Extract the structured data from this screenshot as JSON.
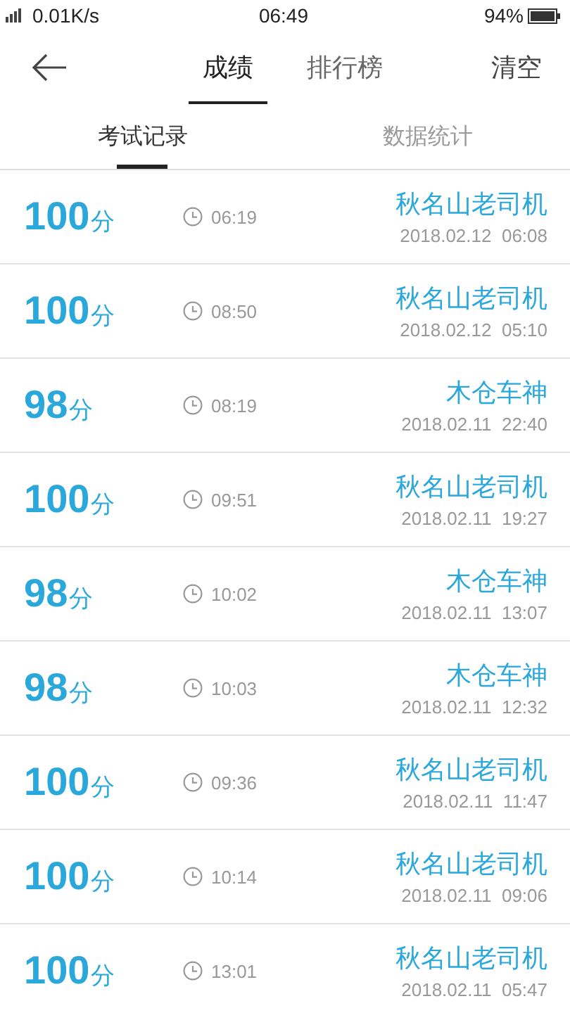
{
  "status_bar": {
    "network": "0.01K/s",
    "time": "06:49",
    "battery": "94%"
  },
  "header": {
    "tabs": [
      {
        "label": "成绩",
        "selected": true
      },
      {
        "label": "排行榜",
        "selected": false
      }
    ],
    "action": "清空"
  },
  "subtabs": [
    {
      "label": "考试记录",
      "selected": true
    },
    {
      "label": "数据统计",
      "selected": false
    }
  ],
  "records": [
    {
      "score": "100",
      "unit": "分",
      "duration": "06:19",
      "title": "秋名山老司机",
      "date": "2018.02.12  06:08"
    },
    {
      "score": "100",
      "unit": "分",
      "duration": "08:50",
      "title": "秋名山老司机",
      "date": "2018.02.12  05:10"
    },
    {
      "score": "98",
      "unit": "分",
      "duration": "08:19",
      "title": "木仓车神",
      "date": "2018.02.11  22:40"
    },
    {
      "score": "100",
      "unit": "分",
      "duration": "09:51",
      "title": "秋名山老司机",
      "date": "2018.02.11  19:27"
    },
    {
      "score": "98",
      "unit": "分",
      "duration": "10:02",
      "title": "木仓车神",
      "date": "2018.02.11  13:07"
    },
    {
      "score": "98",
      "unit": "分",
      "duration": "10:03",
      "title": "木仓车神",
      "date": "2018.02.11  12:32"
    },
    {
      "score": "100",
      "unit": "分",
      "duration": "09:36",
      "title": "秋名山老司机",
      "date": "2018.02.11  11:47"
    },
    {
      "score": "100",
      "unit": "分",
      "duration": "10:14",
      "title": "秋名山老司机",
      "date": "2018.02.11  09:06"
    },
    {
      "score": "100",
      "unit": "分",
      "duration": "13:01",
      "title": "秋名山老司机",
      "date": "2018.02.11  05:47"
    }
  ]
}
